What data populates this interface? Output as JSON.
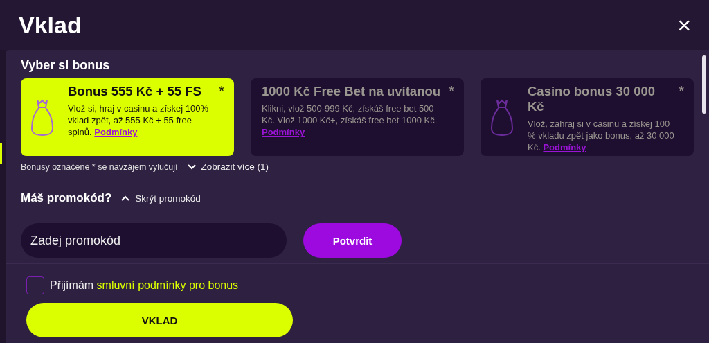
{
  "window": {
    "title": "Vklad",
    "close": "×"
  },
  "bonus_section": {
    "title": "Vyber si bonus",
    "cards": [
      {
        "title": "Bonus 555 Kč + 55 FS",
        "mark": "*",
        "description": "Vlož si, hraj v casinu a získej 100% vklad zpět, až 555 Kč + 55 free spinů.",
        "link": "Podmínky",
        "selected": true,
        "has_icon": true
      },
      {
        "title": "1000 Kč Free Bet na uvítanou",
        "mark": "*",
        "description": "Klikni, vlož 500-999 Kč, získáš free bet 500 Kč. Vlož 1000 Kč+, získáš free bet 1000 Kč.",
        "link": "Podmínky",
        "selected": false,
        "has_icon": false
      },
      {
        "title": "Casino bonus 30 000 Kč",
        "mark": "*",
        "description": "Vlož, zahraj si v casinu a získej 100 % vkladu zpět jako bonus, až 30 000 Kč.",
        "link": "Podmínky",
        "selected": false,
        "has_icon": true
      }
    ],
    "note": "Bonusy označené * se navzájem vylučují",
    "show_more": {
      "label": "Zobrazit více (1)",
      "expanded": false
    }
  },
  "promo": {
    "title": "Máš promokód?",
    "toggle": {
      "label": "Skrýt promokód",
      "expanded": true
    },
    "placeholder": "Zadej promokód",
    "confirm": "Potvrdit"
  },
  "terms": {
    "checked": false,
    "label": "Přijímám",
    "link": "smluvní podmínky pro bonus"
  },
  "submit": "VKLAD"
}
